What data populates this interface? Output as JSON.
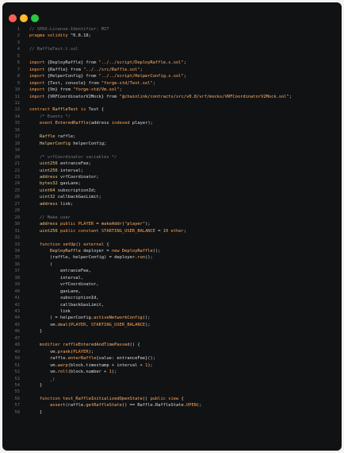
{
  "window": {
    "dots": [
      {
        "name": "close",
        "color": "#ff5f57"
      },
      {
        "name": "minimize",
        "color": "#febc2e"
      },
      {
        "name": "maximize",
        "color": "#28c840"
      }
    ]
  },
  "code": {
    "lines": [
      {
        "n": "1",
        "tokens": [
          {
            "t": "// SPDX-License-Identifier: MIT",
            "c": "com"
          }
        ]
      },
      {
        "n": "2",
        "tokens": [
          {
            "t": "pragma solidity ",
            "c": "kw"
          },
          {
            "t": "^0.8.18;",
            "c": "plain"
          }
        ]
      },
      {
        "n": "3",
        "tokens": []
      },
      {
        "n": "4",
        "tokens": [
          {
            "t": "// RaffleTest.t.sol",
            "c": "com"
          }
        ]
      },
      {
        "n": "5",
        "tokens": []
      },
      {
        "n": "6",
        "tokens": [
          {
            "t": "import ",
            "c": "kw"
          },
          {
            "t": "{DeployRaffle} from ",
            "c": "plain"
          },
          {
            "t": "\"../../script/DeployRaffle.s.sol\"",
            "c": "str"
          },
          {
            "t": ";",
            "c": "plain"
          }
        ]
      },
      {
        "n": "7",
        "tokens": [
          {
            "t": "import ",
            "c": "kw"
          },
          {
            "t": "{Raffle} from ",
            "c": "plain"
          },
          {
            "t": "\"../../src/Raffle.sol\"",
            "c": "str"
          },
          {
            "t": ";",
            "c": "plain"
          }
        ]
      },
      {
        "n": "8",
        "tokens": [
          {
            "t": "import ",
            "c": "kw"
          },
          {
            "t": "{HelperConfig} from ",
            "c": "plain"
          },
          {
            "t": "\"../../script/HelperConfig.s.sol\"",
            "c": "str"
          },
          {
            "t": ";",
            "c": "plain"
          }
        ]
      },
      {
        "n": "9",
        "tokens": [
          {
            "t": "import ",
            "c": "kw"
          },
          {
            "t": "{Test, console} from ",
            "c": "plain"
          },
          {
            "t": "\"forge-std/Test.sol\"",
            "c": "str"
          },
          {
            "t": ";",
            "c": "plain"
          }
        ]
      },
      {
        "n": "10",
        "tokens": [
          {
            "t": "import ",
            "c": "kw"
          },
          {
            "t": "{Vm} from ",
            "c": "plain"
          },
          {
            "t": "\"forge-std/Vm.sol\"",
            "c": "str"
          },
          {
            "t": ";",
            "c": "plain"
          }
        ]
      },
      {
        "n": "11",
        "tokens": [
          {
            "t": "import ",
            "c": "kw"
          },
          {
            "t": "{VRFCoordinatorV2Mock} from ",
            "c": "plain"
          },
          {
            "t": "\"@chainlink/contracts/src/v0.8/vrf/mocks/VRFCoordinatorV2Mock.sol\"",
            "c": "str"
          },
          {
            "t": ";",
            "c": "plain"
          }
        ]
      },
      {
        "n": "12",
        "tokens": []
      },
      {
        "n": "13",
        "tokens": [
          {
            "t": "contract ",
            "c": "kw"
          },
          {
            "t": "RaffleTest ",
            "c": "type"
          },
          {
            "t": "is ",
            "c": "kw"
          },
          {
            "t": "Test {",
            "c": "plain"
          }
        ]
      },
      {
        "n": "14",
        "tokens": [
          {
            "t": "    /* Events */",
            "c": "com"
          }
        ]
      },
      {
        "n": "15",
        "tokens": [
          {
            "t": "    event ",
            "c": "kw"
          },
          {
            "t": "EnteredRaffle",
            "c": "fn"
          },
          {
            "t": "(address ",
            "c": "plain"
          },
          {
            "t": "indexed ",
            "c": "kw"
          },
          {
            "t": "player);",
            "c": "plain"
          }
        ]
      },
      {
        "n": "16",
        "tokens": []
      },
      {
        "n": "17",
        "tokens": [
          {
            "t": "    Raffle ",
            "c": "type"
          },
          {
            "t": "raffle;",
            "c": "plain"
          }
        ]
      },
      {
        "n": "18",
        "tokens": [
          {
            "t": "    HelperConfig ",
            "c": "type"
          },
          {
            "t": "helperConfig;",
            "c": "plain"
          }
        ]
      },
      {
        "n": "19",
        "tokens": []
      },
      {
        "n": "20",
        "tokens": [
          {
            "t": "    /* vrfCoordinator variables */",
            "c": "com"
          }
        ]
      },
      {
        "n": "21",
        "tokens": [
          {
            "t": "    uint256 ",
            "c": "type"
          },
          {
            "t": "entranceFee;",
            "c": "plain"
          }
        ]
      },
      {
        "n": "22",
        "tokens": [
          {
            "t": "    uint256 ",
            "c": "type"
          },
          {
            "t": "interval;",
            "c": "plain"
          }
        ]
      },
      {
        "n": "23",
        "tokens": [
          {
            "t": "    address ",
            "c": "type"
          },
          {
            "t": "vrfCoordinator;",
            "c": "plain"
          }
        ]
      },
      {
        "n": "24",
        "tokens": [
          {
            "t": "    bytes32 ",
            "c": "type"
          },
          {
            "t": "gasLane;",
            "c": "plain"
          }
        ]
      },
      {
        "n": "25",
        "tokens": [
          {
            "t": "    uint64 ",
            "c": "type"
          },
          {
            "t": "subscriptionId;",
            "c": "plain"
          }
        ]
      },
      {
        "n": "26",
        "tokens": [
          {
            "t": "    uint32 ",
            "c": "type"
          },
          {
            "t": "callbackGasLimit;",
            "c": "plain"
          }
        ]
      },
      {
        "n": "27",
        "tokens": [
          {
            "t": "    address ",
            "c": "type"
          },
          {
            "t": "link;",
            "c": "plain"
          }
        ]
      },
      {
        "n": "28",
        "tokens": []
      },
      {
        "n": "29",
        "tokens": [
          {
            "t": "    // Make user",
            "c": "com"
          }
        ]
      },
      {
        "n": "30",
        "tokens": [
          {
            "t": "    address ",
            "c": "type"
          },
          {
            "t": "public ",
            "c": "kw"
          },
          {
            "t": "PLAYER",
            "c": "const"
          },
          {
            "t": " = ",
            "c": "plain"
          },
          {
            "t": "makeAddr",
            "c": "fn"
          },
          {
            "t": "(",
            "c": "plain"
          },
          {
            "t": "\"player\"",
            "c": "str"
          },
          {
            "t": ");",
            "c": "plain"
          }
        ]
      },
      {
        "n": "31",
        "tokens": [
          {
            "t": "    uint256 ",
            "c": "type"
          },
          {
            "t": "public constant ",
            "c": "kw"
          },
          {
            "t": "STARTING_USER_BALANCE",
            "c": "const"
          },
          {
            "t": " = ",
            "c": "plain"
          },
          {
            "t": "10 ether",
            "c": "num"
          },
          {
            "t": ";",
            "c": "plain"
          }
        ]
      },
      {
        "n": "32",
        "tokens": []
      },
      {
        "n": "33",
        "tokens": [
          {
            "t": "    function ",
            "c": "kw"
          },
          {
            "t": "setUp",
            "c": "fn"
          },
          {
            "t": "() ",
            "c": "plain"
          },
          {
            "t": "external ",
            "c": "kw"
          },
          {
            "t": "{",
            "c": "plain"
          }
        ]
      },
      {
        "n": "34",
        "tokens": [
          {
            "t": "        DeployRaffle ",
            "c": "type"
          },
          {
            "t": "deployer = ",
            "c": "plain"
          },
          {
            "t": "new ",
            "c": "kw"
          },
          {
            "t": "DeployRaffle",
            "c": "fn"
          },
          {
            "t": "();",
            "c": "plain"
          }
        ]
      },
      {
        "n": "35",
        "tokens": [
          {
            "t": "        (raffle, helperConfig) = deployer.",
            "c": "plain"
          },
          {
            "t": "run",
            "c": "fn"
          },
          {
            "t": "();",
            "c": "plain"
          }
        ]
      },
      {
        "n": "36",
        "tokens": [
          {
            "t": "        (",
            "c": "plain"
          }
        ]
      },
      {
        "n": "37",
        "tokens": [
          {
            "t": "            entranceFee,",
            "c": "plain"
          }
        ]
      },
      {
        "n": "38",
        "tokens": [
          {
            "t": "            interval,",
            "c": "plain"
          }
        ]
      },
      {
        "n": "39",
        "tokens": [
          {
            "t": "            vrfCoordinator,",
            "c": "plain"
          }
        ]
      },
      {
        "n": "40",
        "tokens": [
          {
            "t": "            gasLane,",
            "c": "plain"
          }
        ]
      },
      {
        "n": "41",
        "tokens": [
          {
            "t": "            subscriptionId,",
            "c": "plain"
          }
        ]
      },
      {
        "n": "42",
        "tokens": [
          {
            "t": "            callbackGasLimit,",
            "c": "plain"
          }
        ]
      },
      {
        "n": "43",
        "tokens": [
          {
            "t": "            link",
            "c": "plain"
          }
        ]
      },
      {
        "n": "44",
        "tokens": [
          {
            "t": "        ) = helperConfig.",
            "c": "plain"
          },
          {
            "t": "activeNetworkConfig",
            "c": "fn"
          },
          {
            "t": "();",
            "c": "plain"
          }
        ]
      },
      {
        "n": "45",
        "tokens": [
          {
            "t": "        vm.",
            "c": "plain"
          },
          {
            "t": "deal",
            "c": "fn"
          },
          {
            "t": "(",
            "c": "plain"
          },
          {
            "t": "PLAYER",
            "c": "const"
          },
          {
            "t": ", ",
            "c": "plain"
          },
          {
            "t": "STARTING_USER_BALANCE",
            "c": "const"
          },
          {
            "t": ");",
            "c": "plain"
          }
        ]
      },
      {
        "n": "46",
        "tokens": [
          {
            "t": "    }",
            "c": "plain"
          }
        ]
      },
      {
        "n": "47",
        "tokens": []
      },
      {
        "n": "48",
        "tokens": [
          {
            "t": "    modifier ",
            "c": "kw"
          },
          {
            "t": "raffleEnteredAndTimePassed",
            "c": "fn"
          },
          {
            "t": "() {",
            "c": "plain"
          }
        ]
      },
      {
        "n": "49",
        "tokens": [
          {
            "t": "        vm.",
            "c": "plain"
          },
          {
            "t": "prank",
            "c": "fn"
          },
          {
            "t": "(",
            "c": "plain"
          },
          {
            "t": "PLAYER",
            "c": "const"
          },
          {
            "t": ");",
            "c": "plain"
          }
        ]
      },
      {
        "n": "50",
        "tokens": [
          {
            "t": "        raffle.",
            "c": "plain"
          },
          {
            "t": "enterRaffle",
            "c": "fn"
          },
          {
            "t": "{value: entranceFee}();",
            "c": "plain"
          }
        ]
      },
      {
        "n": "51",
        "tokens": [
          {
            "t": "        vm.",
            "c": "plain"
          },
          {
            "t": "warp",
            "c": "fn"
          },
          {
            "t": "(block.timestamp + interval + ",
            "c": "plain"
          },
          {
            "t": "1",
            "c": "num"
          },
          {
            "t": ");",
            "c": "plain"
          }
        ]
      },
      {
        "n": "52",
        "tokens": [
          {
            "t": "        vm.",
            "c": "plain"
          },
          {
            "t": "roll",
            "c": "fn"
          },
          {
            "t": "(block.number + ",
            "c": "plain"
          },
          {
            "t": "1",
            "c": "num"
          },
          {
            "t": ");",
            "c": "plain"
          }
        ]
      },
      {
        "n": "53",
        "tokens": [
          {
            "t": "        _;",
            "c": "plain"
          }
        ]
      },
      {
        "n": "54",
        "tokens": [
          {
            "t": "    }",
            "c": "plain"
          }
        ]
      },
      {
        "n": "55",
        "tokens": []
      },
      {
        "n": "56",
        "tokens": [
          {
            "t": "    function ",
            "c": "kw"
          },
          {
            "t": "test_RaffleInitializedOpenState",
            "c": "fn"
          },
          {
            "t": "() ",
            "c": "plain"
          },
          {
            "t": "public view ",
            "c": "kw"
          },
          {
            "t": "{",
            "c": "plain"
          }
        ]
      },
      {
        "n": "57",
        "tokens": [
          {
            "t": "        assert",
            "c": "fn"
          },
          {
            "t": "(raffle.",
            "c": "plain"
          },
          {
            "t": "getRaffleState",
            "c": "fn"
          },
          {
            "t": "() == Raffle.RaffleState.",
            "c": "plain"
          },
          {
            "t": "OPEN",
            "c": "const"
          },
          {
            "t": ");",
            "c": "plain"
          }
        ]
      },
      {
        "n": "58",
        "tokens": [
          {
            "t": "    }",
            "c": "plain"
          }
        ]
      }
    ]
  }
}
